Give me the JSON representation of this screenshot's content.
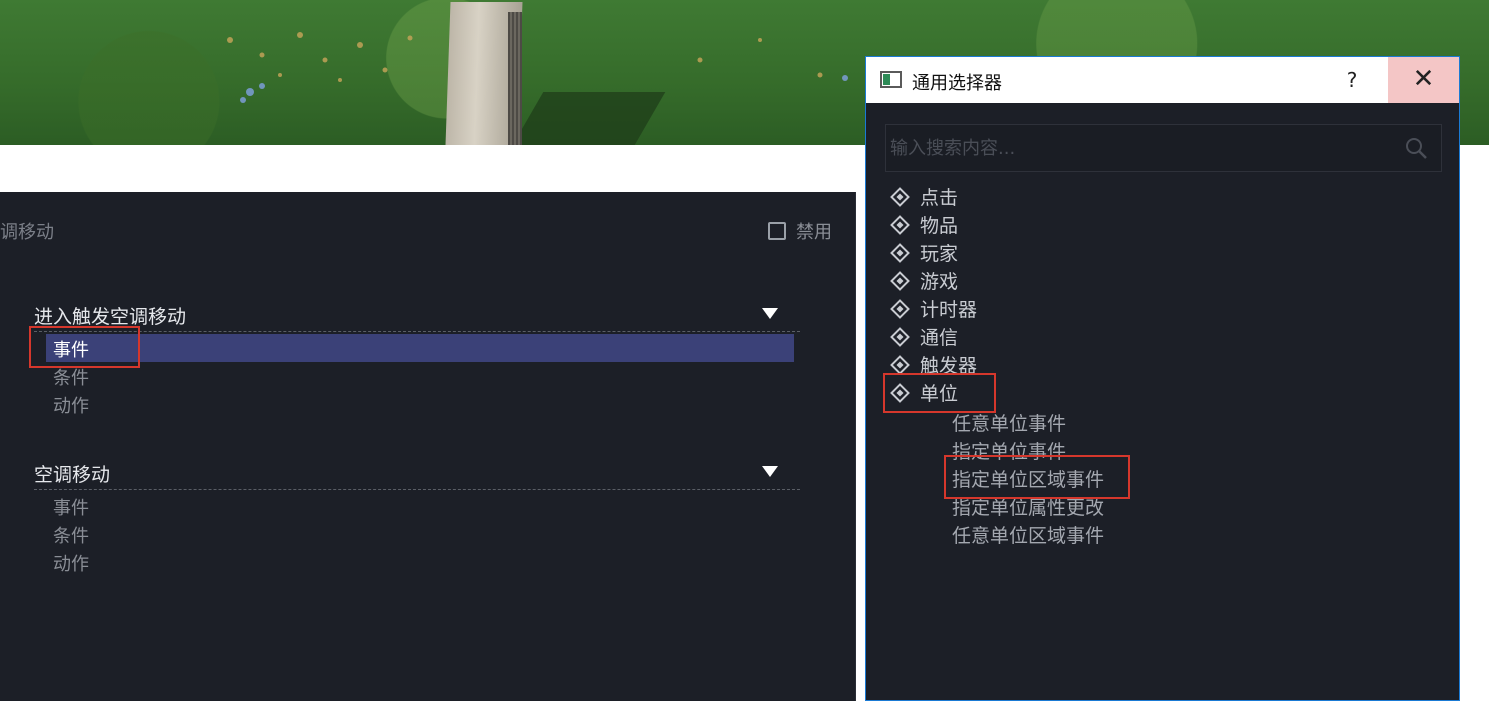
{
  "editor": {
    "breadcrumb": "调移动",
    "disable_label": "禁用",
    "groups": [
      {
        "title": "进入触发空调移动",
        "items": [
          "事件",
          "条件",
          "动作"
        ],
        "selected": "事件"
      },
      {
        "title": "空调移动",
        "items": [
          "事件",
          "条件",
          "动作"
        ]
      }
    ]
  },
  "dialog": {
    "title": "通用选择器",
    "help_label": "?",
    "close_label": "✕",
    "search_placeholder": "输入搜索内容...",
    "categories": [
      "点击",
      "物品",
      "玩家",
      "游戏",
      "计时器",
      "通信",
      "触发器",
      "单位"
    ],
    "expanded_category": "单位",
    "unit_children": [
      "任意单位事件",
      "指定单位事件",
      "指定单位区域事件",
      "指定单位属性更改",
      "任意单位区域事件"
    ]
  },
  "highlights": [
    "事件",
    "单位",
    "指定单位区域事件"
  ],
  "colors": {
    "panel_bg": "#1c1f27",
    "selection": "#3b4178",
    "highlight_box": "#d5372c",
    "dialog_border": "#1a7ad4"
  }
}
